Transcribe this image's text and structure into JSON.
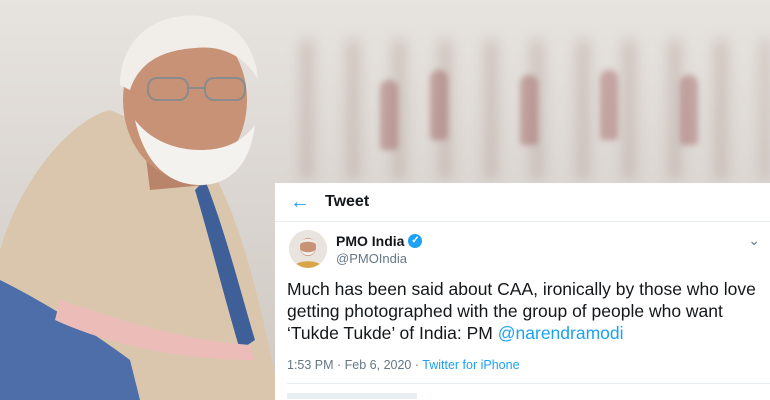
{
  "tweet": {
    "header_title": "Tweet",
    "author": {
      "name": "PMO India",
      "handle": "@PMOIndia"
    },
    "text": "Much has been said about CAA, ironically by those who love getting photographed with the group of people who want ‘Tukde Tukde’ of India: PM ",
    "mention": "@narendramodi",
    "timestamp": "1:53 PM · Feb 6, 2020 · ",
    "source": "Twitter for iPhone"
  },
  "colors": {
    "accent": "#1da1f2",
    "text": "#14171a",
    "muted": "#657786"
  }
}
